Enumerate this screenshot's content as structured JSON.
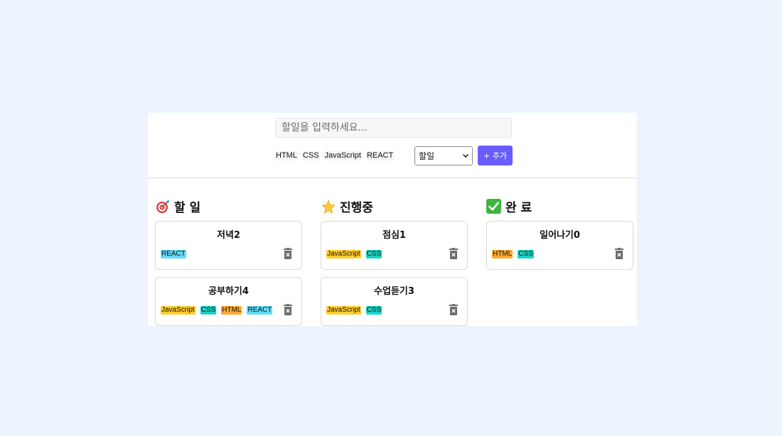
{
  "input": {
    "placeholder": "할일을 입력하세요...",
    "value": ""
  },
  "tag_options": [
    "HTML",
    "CSS",
    "JavaScript",
    "REACT"
  ],
  "status_select": {
    "selected": "할일"
  },
  "add_button": {
    "label": "+ 추가"
  },
  "tag_colors": {
    "HTML": "#ffa832",
    "CSS": "#18d3c5",
    "JavaScript": "#ffcd2e",
    "REACT": "#62daf8"
  },
  "columns": [
    {
      "id": "todo",
      "icon": "target-icon",
      "title": "할 일",
      "cards": [
        {
          "title": "저녁2",
          "tags": [
            "REACT"
          ]
        },
        {
          "title": "공부하기4",
          "tags": [
            "JavaScript",
            "CSS",
            "HTML",
            "REACT"
          ]
        }
      ]
    },
    {
      "id": "doing",
      "icon": "sparkle-star-icon",
      "title": "진행중",
      "cards": [
        {
          "title": "점심1",
          "tags": [
            "JavaScript",
            "CSS"
          ]
        },
        {
          "title": "수업듣기3",
          "tags": [
            "JavaScript",
            "CSS"
          ]
        }
      ]
    },
    {
      "id": "done",
      "icon": "check-mark-icon",
      "title": "완 료",
      "cards": [
        {
          "title": "일어나기0",
          "tags": [
            "HTML",
            "CSS"
          ]
        }
      ]
    }
  ]
}
